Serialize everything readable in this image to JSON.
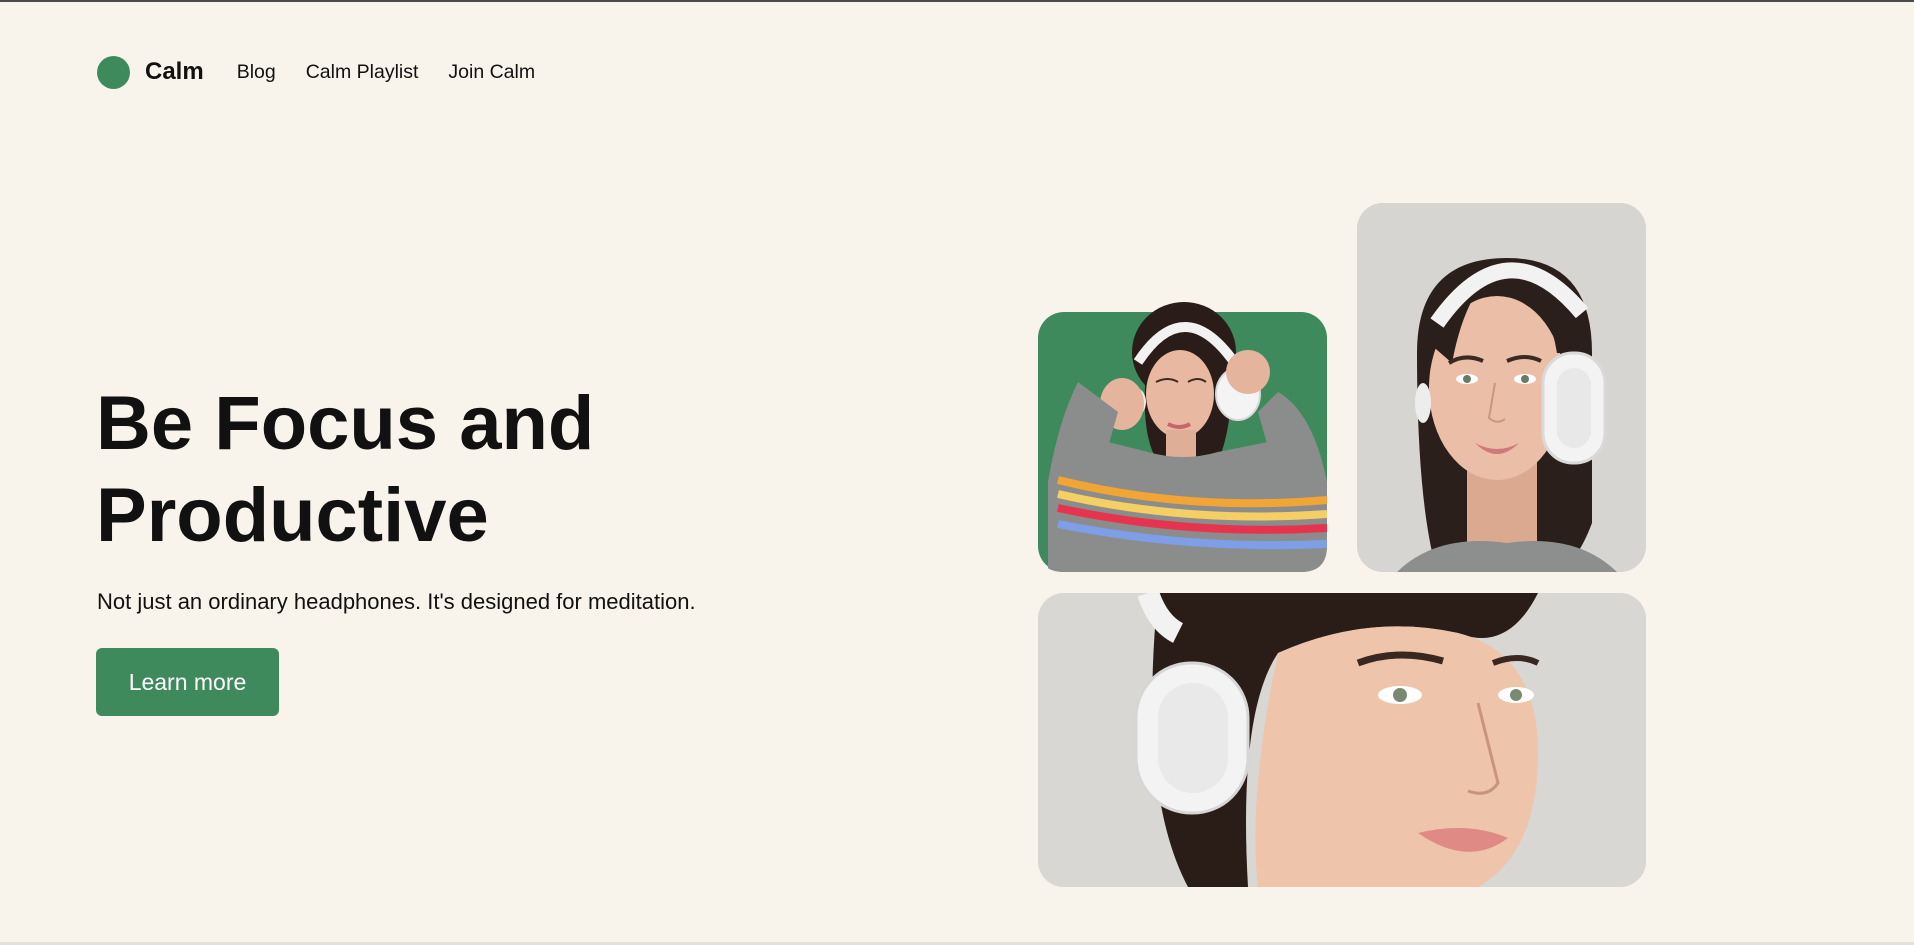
{
  "brand": {
    "name": "Calm",
    "accent_color": "#3f8a5d",
    "background_color": "#f8f4ec"
  },
  "nav": {
    "links": [
      {
        "label": "Blog"
      },
      {
        "label": "Calm Playlist"
      },
      {
        "label": "Join Calm"
      }
    ]
  },
  "hero": {
    "title_line1": "Be Focus and",
    "title_line2": "Productive",
    "subtitle": "Not just an ordinary headphones. It's designed for meditation.",
    "cta_label": "Learn more"
  },
  "images": [
    {
      "name": "woman-green-background-photo"
    },
    {
      "name": "woman-portrait-photo"
    },
    {
      "name": "woman-closeup-photo"
    }
  ]
}
